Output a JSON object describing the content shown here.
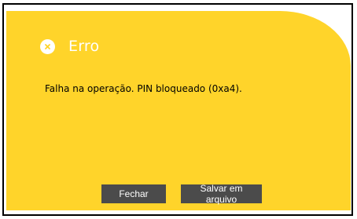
{
  "dialog": {
    "title": "Erro",
    "icon": "error-icon",
    "message": "Falha na operação. PIN bloqueado (0xa4).",
    "colors": {
      "background": "#ffd42a",
      "button": "#4b4b4b",
      "title_text": "#ffffff"
    }
  },
  "buttons": {
    "close_label": "Fechar",
    "save_label": "Salvar em arquivo"
  }
}
